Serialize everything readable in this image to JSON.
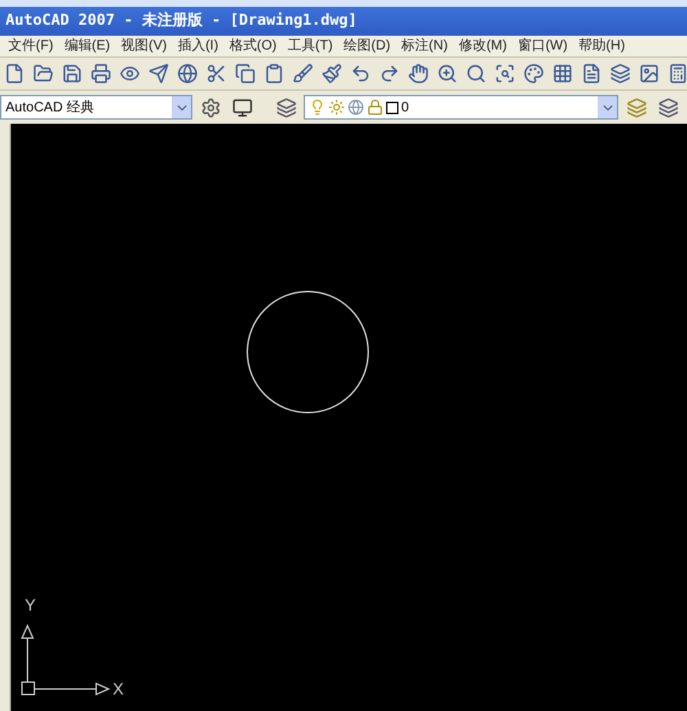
{
  "window": {
    "title": "AutoCAD 2007 - 未注册版 - [Drawing1.dwg]"
  },
  "menu": [
    "文件(F)",
    "编辑(E)",
    "视图(V)",
    "插入(I)",
    "格式(O)",
    "工具(T)",
    "绘图(D)",
    "标注(N)",
    "修改(M)",
    "窗口(W)",
    "帮助(H)"
  ],
  "workspace": {
    "value": "AutoCAD 经典"
  },
  "layer": {
    "value": "0"
  },
  "ucs": {
    "x_label": "X",
    "y_label": "Y"
  }
}
